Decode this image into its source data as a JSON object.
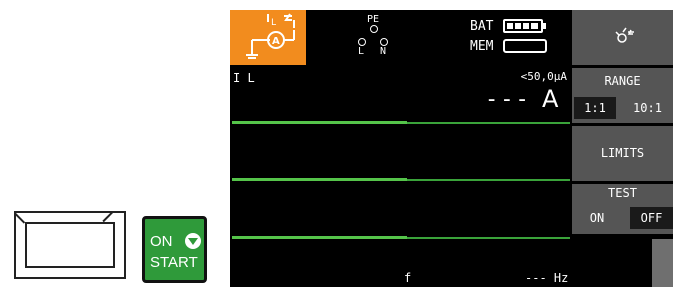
{
  "device": {
    "bottom_left_key_label": "",
    "onstart_key": {
      "on": "ON",
      "start": "START"
    }
  },
  "header": {
    "mode_icon": "leakage-current-clamp-icon",
    "pe_label": "PE",
    "l_label": "L",
    "n_label": "N",
    "bat_label": "BAT",
    "mem_label": "MEM",
    "battery_level": 1.0
  },
  "measurement": {
    "quantity_label": "I L",
    "limit_text": "<50,0µA",
    "value_text": "---",
    "unit": "A",
    "freq_label": "f",
    "freq_value": "--- Hz"
  },
  "softkeys": {
    "probe_icon": "probe-settings-icon",
    "range_title": "RANGE",
    "range_options": [
      "1:1",
      "10:1"
    ],
    "range_selected": "1:1",
    "limits_label": "LIMITS",
    "test_title": "TEST",
    "test_options": [
      "ON",
      "OFF"
    ],
    "test_selected": "OFF"
  },
  "colors": {
    "accent_orange": "#f28c1e",
    "trace_green": "#3aa33a",
    "softkey_gray": "#555555",
    "start_green": "#2f9a3a"
  }
}
